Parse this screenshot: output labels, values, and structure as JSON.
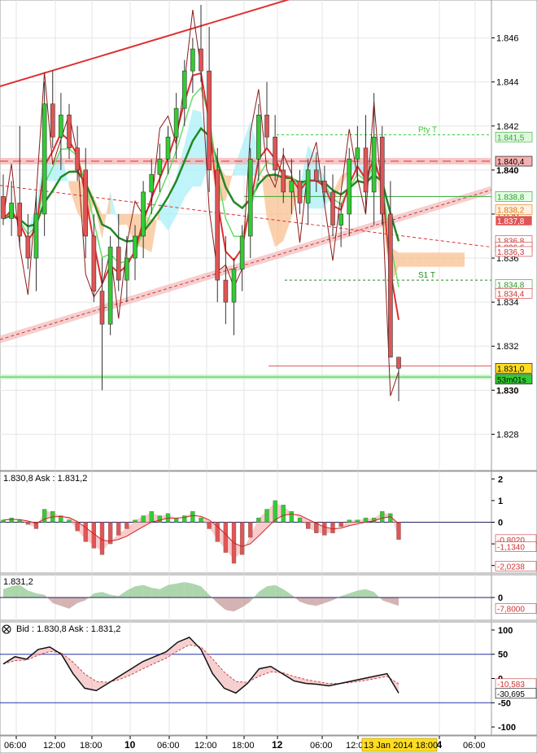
{
  "colors": {
    "bull": "#33cc33",
    "bear": "#e05555",
    "cloud_up": "#a8f0f8",
    "cloud_down": "#f8c090",
    "grid": "#e6e6e6",
    "axis_text": "#000000",
    "hist_up": "#33cc33",
    "hist_down": "#e05555"
  },
  "chart_data": [
    {
      "type": "line",
      "name": "price",
      "y_ticks": [
        "1.846",
        "1.844",
        "1.842",
        "1.840",
        "1.838",
        "1.836",
        "1.834",
        "1.832",
        "1.830",
        "1.828"
      ],
      "ylim": [
        1.8265,
        1.8475
      ],
      "x_ticks": [
        "06:00",
        "12:00",
        "18:00",
        "10",
        "06:00",
        "12:00",
        "18:00",
        "12",
        "06:00",
        "12:00",
        "4",
        "06:00"
      ],
      "time_label": "13 Jan 2014 18:00",
      "price_labels": [
        {
          "text": "1.841,5",
          "value": 1.8415,
          "color": "#dff7df",
          "fg": "#33aa33"
        },
        {
          "text": "1.840,4",
          "value": 1.8404,
          "color": "#f5b0b0",
          "fg": "#000000"
        },
        {
          "text": "1.838,8",
          "value": 1.8388,
          "color": "#e6ffe6",
          "fg": "#229922"
        },
        {
          "text": "1.838,2",
          "value": 1.8382,
          "color": "#fff0e0",
          "fg": "#dd7711"
        },
        {
          "text": "1.837,8",
          "value": 1.8377,
          "color": "#e05555",
          "fg": "#ffffff"
        },
        {
          "text": "1.836,8",
          "value": 1.8368,
          "color": "#ffffff",
          "fg": "#cc3333"
        },
        {
          "text": "1.836,6",
          "value": 1.8365,
          "color": "#ffffff",
          "fg": "#cc3333"
        },
        {
          "text": "1.836,3",
          "value": 1.8363,
          "color": "#ffffff",
          "fg": "#cc3333"
        },
        {
          "text": "1.834,8",
          "value": 1.8348,
          "color": "#ffffff",
          "fg": "#229922"
        },
        {
          "text": "1.834,4",
          "value": 1.8344,
          "color": "#ffffff",
          "fg": "#cc3333"
        },
        {
          "text": "1.831,0",
          "value": 1.831,
          "color": "#ffdd22",
          "fg": "#000000"
        },
        {
          "text": "53m01s",
          "value": 1.8305,
          "color": "#33cc33",
          "fg": "#000000"
        }
      ],
      "annotations": [
        {
          "text": "Pty T",
          "value": 1.8416,
          "color": "#33cc33"
        },
        {
          "text": "S1 T",
          "value": 1.835,
          "color": "#228822"
        }
      ],
      "candles": [
        [
          1.8388,
          1.8398,
          1.8375,
          1.8378
        ],
        [
          1.8378,
          1.8395,
          1.837,
          1.8385
        ],
        [
          1.8385,
          1.842,
          1.8365,
          1.837
        ],
        [
          1.837,
          1.838,
          1.8355,
          1.836
        ],
        [
          1.836,
          1.839,
          1.8345,
          1.838
        ],
        [
          1.838,
          1.844,
          1.837,
          1.843
        ],
        [
          1.843,
          1.8445,
          1.841,
          1.8415
        ],
        [
          1.8415,
          1.8435,
          1.84,
          1.8425
        ],
        [
          1.8425,
          1.843,
          1.8405,
          1.841
        ],
        [
          1.841,
          1.842,
          1.8395,
          1.84
        ],
        [
          1.84,
          1.841,
          1.836,
          1.837
        ],
        [
          1.837,
          1.838,
          1.834,
          1.8345
        ],
        [
          1.8345,
          1.836,
          1.83,
          1.833
        ],
        [
          1.833,
          1.837,
          1.8325,
          1.8365
        ],
        [
          1.8365,
          1.838,
          1.8345,
          1.835
        ],
        [
          1.835,
          1.837,
          1.834,
          1.836
        ],
        [
          1.836,
          1.8375,
          1.835,
          1.837
        ],
        [
          1.837,
          1.8395,
          1.836,
          1.839
        ],
        [
          1.839,
          1.8405,
          1.838,
          1.8398
        ],
        [
          1.8398,
          1.8412,
          1.839,
          1.8405
        ],
        [
          1.8405,
          1.842,
          1.8398,
          1.8415
        ],
        [
          1.8415,
          1.8435,
          1.8405,
          1.8428
        ],
        [
          1.8428,
          1.845,
          1.842,
          1.8445
        ],
        [
          1.8445,
          1.846,
          1.8435,
          1.8455
        ],
        [
          1.8455,
          1.8475,
          1.844,
          1.8445
        ],
        [
          1.8445,
          1.8465,
          1.839,
          1.84
        ],
        [
          1.84,
          1.841,
          1.834,
          1.835
        ],
        [
          1.835,
          1.837,
          1.833,
          1.834
        ],
        [
          1.834,
          1.836,
          1.8325,
          1.8355
        ],
        [
          1.8355,
          1.8375,
          1.8345,
          1.837
        ],
        [
          1.837,
          1.841,
          1.836,
          1.8405
        ],
        [
          1.8405,
          1.843,
          1.8395,
          1.8425
        ],
        [
          1.8425,
          1.844,
          1.841,
          1.8415
        ],
        [
          1.8415,
          1.8425,
          1.8395,
          1.84
        ],
        [
          1.84,
          1.841,
          1.8385,
          1.839
        ],
        [
          1.839,
          1.8405,
          1.838,
          1.8395
        ],
        [
          1.8395,
          1.84,
          1.838,
          1.8385
        ],
        [
          1.8385,
          1.8405,
          1.8375,
          1.84
        ],
        [
          1.84,
          1.8408,
          1.839,
          1.8395
        ],
        [
          1.8395,
          1.8402,
          1.8385,
          1.839
        ],
        [
          1.839,
          1.8398,
          1.837,
          1.8375
        ],
        [
          1.8375,
          1.8385,
          1.8365,
          1.838
        ],
        [
          1.838,
          1.841,
          1.837,
          1.8405
        ],
        [
          1.8405,
          1.842,
          1.8395,
          1.841
        ],
        [
          1.841,
          1.8425,
          1.838,
          1.839
        ],
        [
          1.839,
          1.8435,
          1.8375,
          1.8415
        ],
        [
          1.8415,
          1.842,
          1.8375,
          1.838
        ],
        [
          1.838,
          1.8395,
          1.8315,
          1.8315
        ],
        [
          1.8315,
          1.8315,
          1.8295,
          1.831
        ]
      ]
    },
    {
      "type": "bar",
      "name": "macd",
      "header": "1.830,8 Ask : 1.831,2",
      "y_ticks": [
        "2",
        "1",
        "0",
        "-1",
        "-2"
      ],
      "ylim": [
        -2.2,
        2.2
      ],
      "price_labels": [
        {
          "text": "-0,8020",
          "value": -0.802,
          "color": "#ffffff",
          "fg": "#cc3333"
        },
        {
          "text": "-1,1340",
          "value": -1.134,
          "color": "#ffffff",
          "fg": "#cc3333"
        },
        {
          "text": "-2,0238",
          "value": -2.0238,
          "color": "#ffffff",
          "fg": "#cc3333"
        }
      ],
      "values": [
        0.1,
        0.2,
        0.1,
        -0.1,
        -0.3,
        0.6,
        0.5,
        0.3,
        0.1,
        -0.4,
        -0.9,
        -1.2,
        -1.5,
        -1.0,
        -0.6,
        -0.3,
        0.1,
        0.3,
        0.5,
        0.3,
        0.4,
        0.2,
        0.3,
        0.5,
        0.2,
        -0.3,
        -0.9,
        -1.4,
        -1.9,
        -1.5,
        -0.7,
        0.2,
        0.6,
        1.0,
        0.8,
        0.5,
        0.2,
        -0.3,
        -0.5,
        -0.6,
        -0.5,
        -0.2,
        0.1,
        0.1,
        0.2,
        0.2,
        0.5,
        0.4,
        -0.8
      ]
    },
    {
      "type": "area",
      "name": "oscillator",
      "header": "1.831,2",
      "y_ticks": [
        "0"
      ],
      "ylim": [
        -14,
        14
      ],
      "price_labels": [
        {
          "text": "-7,8000",
          "value": -7.8,
          "color": "#ffffff",
          "fg": "#cc3333"
        }
      ],
      "values": [
        6,
        8,
        9,
        5,
        3,
        2,
        -4,
        -6,
        -8,
        -4,
        -2,
        3,
        4,
        2,
        1,
        5,
        8,
        9,
        7,
        6,
        9,
        10,
        11,
        10,
        8,
        2,
        -4,
        -9,
        -10,
        -7,
        -3,
        4,
        8,
        9,
        6,
        2,
        -3,
        -5,
        -6,
        -4,
        -2,
        1,
        3,
        5,
        6,
        4,
        -2,
        -4,
        -6
      ]
    },
    {
      "type": "line",
      "name": "stochastic",
      "header": "Bid : 1.830,8 Ask : 1.831,2",
      "y_ticks": [
        "100",
        "50",
        "0",
        "-50",
        "-100"
      ],
      "ylim": [
        -110,
        110
      ],
      "price_labels": [
        {
          "text": "-10,583",
          "value": -10.583,
          "color": "#ffffff",
          "fg": "#cc3333"
        },
        {
          "text": "-30,695",
          "value": -30.695,
          "color": "#ffffff",
          "fg": "#000000"
        }
      ],
      "values": [
        30,
        45,
        40,
        60,
        65,
        50,
        10,
        -20,
        -25,
        -10,
        5,
        20,
        35,
        45,
        55,
        75,
        85,
        60,
        10,
        -20,
        -30,
        -10,
        20,
        25,
        10,
        -5,
        -10,
        -12,
        -15,
        -10,
        -5,
        0,
        5,
        10,
        -30
      ]
    }
  ]
}
